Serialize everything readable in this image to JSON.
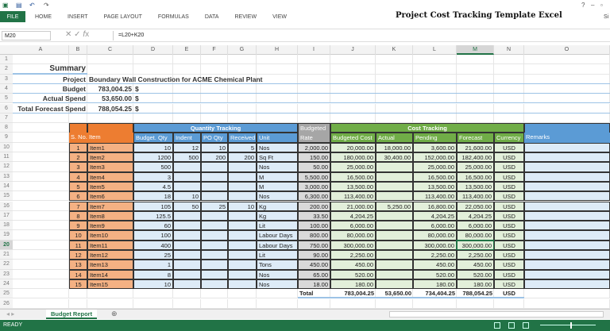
{
  "window": {
    "title": "Project Cost Tracking Template Excel",
    "signin": "Si"
  },
  "ribbon": {
    "tabs": [
      "FILE",
      "HOME",
      "INSERT",
      "PAGE LAYOUT",
      "FORMULAS",
      "DATA",
      "REVIEW",
      "VIEW"
    ]
  },
  "formula_bar": {
    "name_box": "M20",
    "formula": "=L20+K20"
  },
  "columns": [
    "A",
    "B",
    "C",
    "D",
    "E",
    "F",
    "G",
    "H",
    "I",
    "J",
    "K",
    "L",
    "M",
    "N",
    "O"
  ],
  "selected_cell": {
    "column": "M",
    "row": 20
  },
  "summary": {
    "title": "Summary",
    "project_label": "Project",
    "project_value": "Boundary Wall Construction for ACME Chemical Plant",
    "budget_label": "Budget",
    "budget_value": "783,004.25",
    "actual_label": "Actual Spend",
    "actual_value": "53,650.00",
    "forecast_label": "Total Forecast Spend",
    "forecast_value": "788,054.25",
    "currency_symbol": "$"
  },
  "table": {
    "group_quantity": "Quantity Tracking",
    "group_cost": "Cost Tracking",
    "headers": {
      "sno": "S. No.",
      "item": "Item",
      "budget_qty": "Budget. Qty",
      "indent": "Indent",
      "po_qty": "PO Qty",
      "received": "Received",
      "unit": "Unit",
      "rate": "Budgeted Rate",
      "budgeted_cost": "Budgeted Cost",
      "actual": "Actual",
      "pending": "Pending",
      "forecast": "Forecast",
      "currency": "Currency",
      "remarks": "Remarks"
    },
    "rows": [
      {
        "sno": "1",
        "item": "Item1",
        "budget_qty": "10",
        "indent": "12",
        "po_qty": "10",
        "received": "5",
        "unit": "Nos",
        "rate": "2,000.00",
        "budgeted_cost": "20,000.00",
        "actual": "18,000.00",
        "pending": "3,600.00",
        "forecast": "21,600.00",
        "currency": "USD",
        "remarks": ""
      },
      {
        "sno": "2",
        "item": "Item2",
        "budget_qty": "1200",
        "indent": "500",
        "po_qty": "200",
        "received": "200",
        "unit": "Sq Ft",
        "rate": "150.00",
        "budgeted_cost": "180,000.00",
        "actual": "30,400.00",
        "pending": "152,000.00",
        "forecast": "182,400.00",
        "currency": "USD",
        "remarks": ""
      },
      {
        "sno": "3",
        "item": "Item3",
        "budget_qty": "500",
        "indent": "",
        "po_qty": "",
        "received": "",
        "unit": "Nos",
        "rate": "50.00",
        "budgeted_cost": "25,000.00",
        "actual": "",
        "pending": "25,000.00",
        "forecast": "25,000.00",
        "currency": "USD",
        "remarks": ""
      },
      {
        "sno": "4",
        "item": "Item4",
        "budget_qty": "3",
        "indent": "",
        "po_qty": "",
        "received": "",
        "unit": "M",
        "rate": "5,500.00",
        "budgeted_cost": "16,500.00",
        "actual": "",
        "pending": "16,500.00",
        "forecast": "16,500.00",
        "currency": "USD",
        "remarks": ""
      },
      {
        "sno": "5",
        "item": "Item5",
        "budget_qty": "4.5",
        "indent": "",
        "po_qty": "",
        "received": "",
        "unit": "M",
        "rate": "3,000.00",
        "budgeted_cost": "13,500.00",
        "actual": "",
        "pending": "13,500.00",
        "forecast": "13,500.00",
        "currency": "USD",
        "remarks": ""
      },
      {
        "sno": "6",
        "item": "Item6",
        "budget_qty": "18",
        "indent": "10",
        "po_qty": "",
        "received": "",
        "unit": "Nos",
        "rate": "6,300.00",
        "budgeted_cost": "113,400.00",
        "actual": "",
        "pending": "113,400.00",
        "forecast": "113,400.00",
        "currency": "USD",
        "remarks": ""
      },
      {
        "sno": "7",
        "item": "Item7",
        "budget_qty": "105",
        "indent": "50",
        "po_qty": "25",
        "received": "10",
        "unit": "Kg",
        "rate": "200.00",
        "budgeted_cost": "21,000.00",
        "actual": "5,250.00",
        "pending": "16,800.00",
        "forecast": "22,050.00",
        "currency": "USD",
        "remarks": ""
      },
      {
        "sno": "8",
        "item": "Item8",
        "budget_qty": "125.5",
        "indent": "",
        "po_qty": "",
        "received": "",
        "unit": "Kg",
        "rate": "33.50",
        "budgeted_cost": "4,204.25",
        "actual": "",
        "pending": "4,204.25",
        "forecast": "4,204.25",
        "currency": "USD",
        "remarks": ""
      },
      {
        "sno": "9",
        "item": "Item9",
        "budget_qty": "60",
        "indent": "",
        "po_qty": "",
        "received": "",
        "unit": "Lit",
        "rate": "100.00",
        "budgeted_cost": "6,000.00",
        "actual": "",
        "pending": "6,000.00",
        "forecast": "6,000.00",
        "currency": "USD",
        "remarks": ""
      },
      {
        "sno": "10",
        "item": "Item10",
        "budget_qty": "100",
        "indent": "",
        "po_qty": "",
        "received": "",
        "unit": "Labour Days",
        "rate": "800.00",
        "budgeted_cost": "80,000.00",
        "actual": "",
        "pending": "80,000.00",
        "forecast": "80,000.00",
        "currency": "USD",
        "remarks": ""
      },
      {
        "sno": "11",
        "item": "Item11",
        "budget_qty": "400",
        "indent": "",
        "po_qty": "",
        "received": "",
        "unit": "Labour Days",
        "rate": "750.00",
        "budgeted_cost": "300,000.00",
        "actual": "",
        "pending": "300,000.00",
        "forecast": "300,000.00",
        "currency": "USD",
        "remarks": ""
      },
      {
        "sno": "12",
        "item": "Item12",
        "budget_qty": "25",
        "indent": "",
        "po_qty": "",
        "received": "",
        "unit": "Lit",
        "rate": "90.00",
        "budgeted_cost": "2,250.00",
        "actual": "",
        "pending": "2,250.00",
        "forecast": "2,250.00",
        "currency": "USD",
        "remarks": ""
      },
      {
        "sno": "13",
        "item": "Item13",
        "budget_qty": "1",
        "indent": "",
        "po_qty": "",
        "received": "",
        "unit": "Tons",
        "rate": "450.00",
        "budgeted_cost": "450.00",
        "actual": "",
        "pending": "450.00",
        "forecast": "450.00",
        "currency": "USD",
        "remarks": ""
      },
      {
        "sno": "14",
        "item": "Item14",
        "budget_qty": "8",
        "indent": "",
        "po_qty": "",
        "received": "",
        "unit": "Nos",
        "rate": "65.00",
        "budgeted_cost": "520.00",
        "actual": "",
        "pending": "520.00",
        "forecast": "520.00",
        "currency": "USD",
        "remarks": ""
      },
      {
        "sno": "15",
        "item": "Item15",
        "budget_qty": "10",
        "indent": "",
        "po_qty": "",
        "received": "",
        "unit": "Nos",
        "rate": "18.00",
        "budgeted_cost": "180.00",
        "actual": "",
        "pending": "180.00",
        "forecast": "180.00",
        "currency": "USD",
        "remarks": ""
      }
    ],
    "total": {
      "label": "Total",
      "budgeted_cost": "783,004.25",
      "actual": "53,650.00",
      "pending": "734,404.25",
      "forecast": "788,054.25",
      "currency": "USD"
    }
  },
  "sheet_tabs": [
    {
      "label": "Budget Report",
      "active": true
    }
  ],
  "status": {
    "text": "READY"
  },
  "colors": {
    "excel_green": "#217346",
    "orange": "#ed7d31",
    "blue": "#5b9bd5",
    "green": "#70ad47",
    "gray": "#a6a6a6"
  }
}
